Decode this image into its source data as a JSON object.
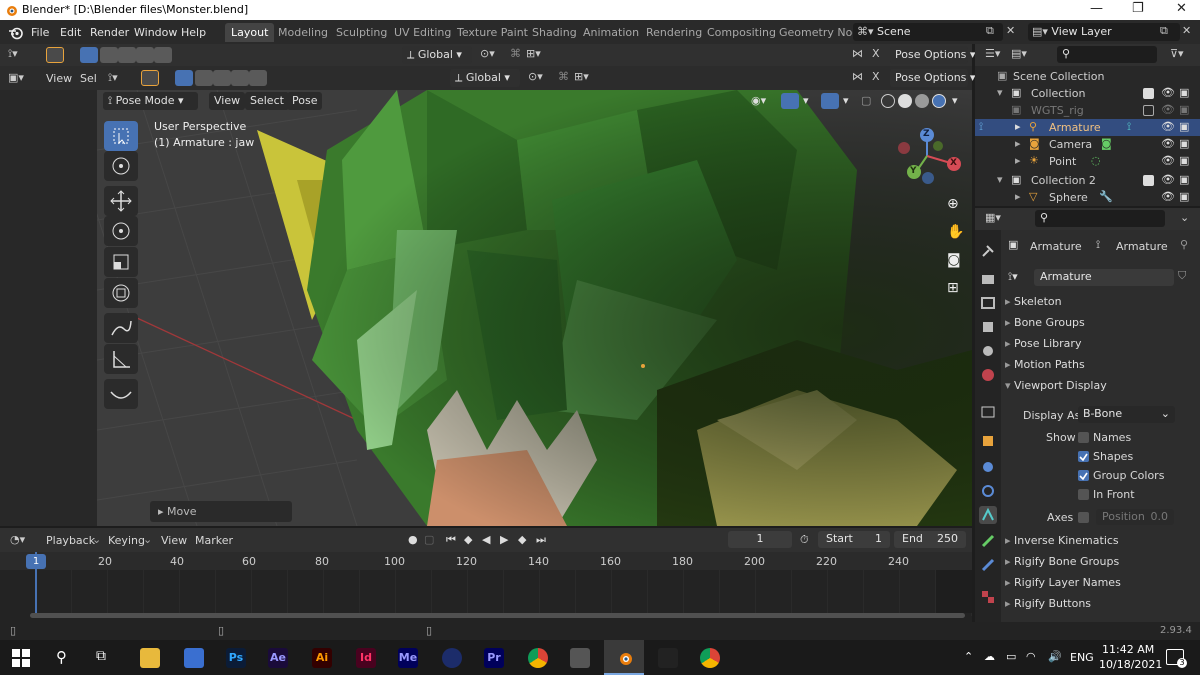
{
  "window": {
    "title": "Blender* [D:\\Blender files\\Monster.blend]"
  },
  "menu": [
    "File",
    "Edit",
    "Render",
    "Window",
    "Help"
  ],
  "workspaces": [
    "Layout",
    "Modeling",
    "Sculpting",
    "UV Editing",
    "Texture Paint",
    "Shading",
    "Animation",
    "Rendering",
    "Compositing",
    "Geometry Nod"
  ],
  "scene": {
    "name": "Scene",
    "view_layer": "View Layer"
  },
  "header1": {
    "orientation": "Global",
    "pose_options": "Pose Options"
  },
  "header2": {
    "view": "View",
    "sel": "Sel",
    "orientation": "Global",
    "pose_options": "Pose Options"
  },
  "viewport_header": {
    "mode": "Pose Mode",
    "view": "View",
    "select": "Select",
    "pose": "Pose"
  },
  "viewport": {
    "perspective": "User Perspective",
    "selection": "(1) Armature : jaw",
    "last_op": "Move"
  },
  "gizmo": {
    "x": "X",
    "y": "Y",
    "z": "Z"
  },
  "outliner": {
    "rows": [
      {
        "label": "Scene Collection"
      },
      {
        "label": "Collection"
      },
      {
        "label": "WGTS_rig"
      },
      {
        "label": "Armature"
      },
      {
        "label": "Camera"
      },
      {
        "label": "Point"
      },
      {
        "label": "Collection 2"
      },
      {
        "label": "Sphere"
      }
    ]
  },
  "properties": {
    "breadcrumb": [
      "Armature",
      "Armature"
    ],
    "data_name": "Armature",
    "panels": [
      "Skeleton",
      "Bone Groups",
      "Pose Library",
      "Motion Paths",
      "Viewport Display"
    ],
    "display_as_label": "Display As",
    "display_as_value": "B-Bone",
    "show_label": "Show",
    "show_options": [
      {
        "label": "Names",
        "checked": false
      },
      {
        "label": "Shapes",
        "checked": true
      },
      {
        "label": "Group Colors",
        "checked": true
      },
      {
        "label": "In Front",
        "checked": false
      }
    ],
    "axes_label": "Axes",
    "axes_position_label": "Position",
    "axes_position_value": "0.0",
    "panels_after": [
      "Inverse Kinematics",
      "Rigify Bone Groups",
      "Rigify Layer Names",
      "Rigify Buttons"
    ]
  },
  "timeline": {
    "menus": [
      "Playback",
      "Keying",
      "View",
      "Marker"
    ],
    "current_frame": "1",
    "start_label": "Start",
    "start": "1",
    "end_label": "End",
    "end": "250",
    "ruler": [
      "1",
      "20",
      "40",
      "60",
      "80",
      "100",
      "120",
      "140",
      "160",
      "180",
      "200",
      "220",
      "240"
    ]
  },
  "status": {
    "version": "2.93.4"
  },
  "taskbar": {
    "apps": [
      "Ps",
      "Ae",
      "Ai",
      "Id",
      "Me",
      "Pr"
    ],
    "language": "ENG",
    "time": "11:42 AM",
    "date": "10/18/2021",
    "notifications": "3"
  },
  "colors": {
    "accent": "#4772b3",
    "selection_row": "#334d80",
    "active_tool": "#4772b3"
  }
}
